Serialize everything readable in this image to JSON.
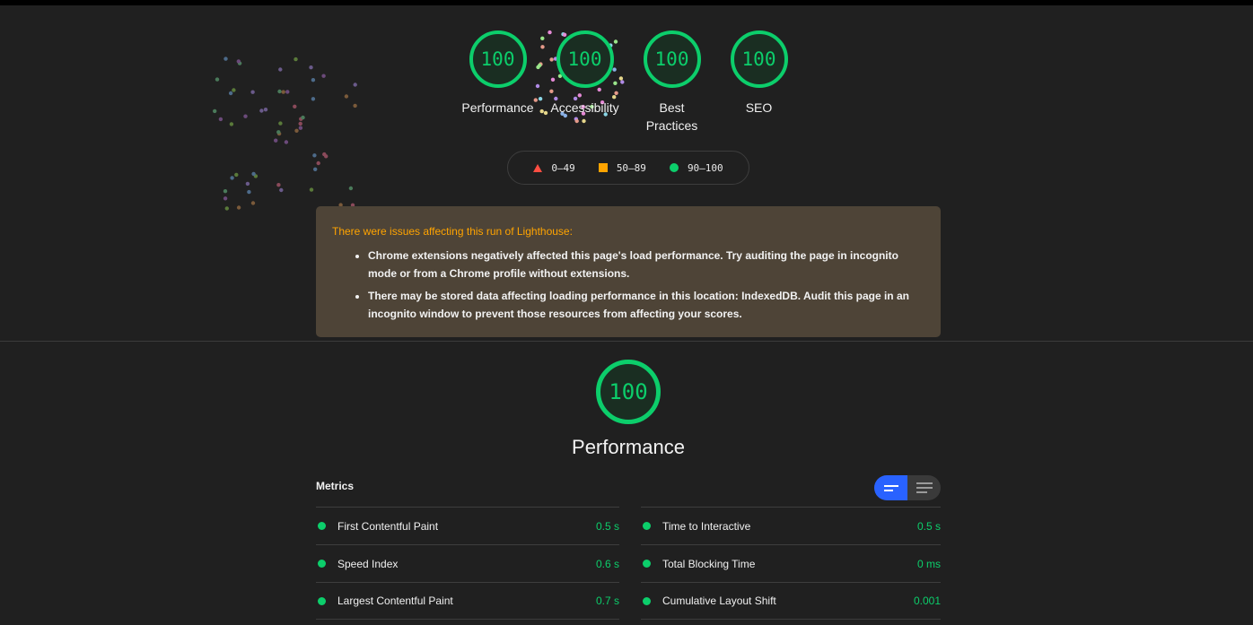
{
  "colors": {
    "pass": "#0cce6b",
    "average": "#ffa400",
    "fail": "#ff4e42",
    "accent": "#2962ff"
  },
  "gauges": [
    {
      "score": "100",
      "label": "Performance"
    },
    {
      "score": "100",
      "label": "Accessibility"
    },
    {
      "score": "100",
      "label": "Best Practices"
    },
    {
      "score": "100",
      "label": "SEO"
    }
  ],
  "legend": {
    "fail": "0–49",
    "average": "50–89",
    "pass": "90–100"
  },
  "warning": {
    "title": "There were issues affecting this run of Lighthouse:",
    "items": [
      "Chrome extensions negatively affected this page's load performance. Try auditing the page in incognito mode or from a Chrome profile without extensions.",
      "There may be stored data affecting loading performance in this location: IndexedDB. Audit this page in an incognito window to prevent those resources from affecting your scores."
    ]
  },
  "performance": {
    "score": "100",
    "title": "Performance"
  },
  "metrics": {
    "heading": "Metrics",
    "left": [
      {
        "name": "First Contentful Paint",
        "value": "0.5 s"
      },
      {
        "name": "Speed Index",
        "value": "0.6 s"
      },
      {
        "name": "Largest Contentful Paint",
        "value": "0.7 s"
      }
    ],
    "right": [
      {
        "name": "Time to Interactive",
        "value": "0.5 s"
      },
      {
        "name": "Total Blocking Time",
        "value": "0 ms"
      },
      {
        "name": "Cumulative Layout Shift",
        "value": "0.001"
      }
    ]
  },
  "icons": {
    "view_toggle_bars": "bar-view-icon",
    "view_toggle_list": "list-view-icon"
  }
}
